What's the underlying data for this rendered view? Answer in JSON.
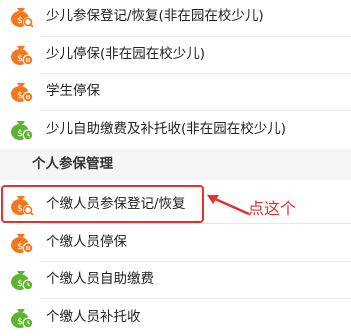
{
  "colors": {
    "accent": "#e5322d",
    "orange_icon": "#f4771c",
    "green_icon": "#5cb531"
  },
  "menu_top": [
    {
      "label": "少儿参保登记/恢复(非在园在校少儿)",
      "icon": "orange-moneybag-search-icon"
    },
    {
      "label": "少儿停保(非在园在校少儿)",
      "icon": "orange-moneybag-pause-icon"
    },
    {
      "label": "学生停保",
      "icon": "orange-moneybag-pause-icon"
    },
    {
      "label": "少儿自助缴费及补托收(非在园在校少儿)",
      "icon": "green-moneybag-clock-icon"
    }
  ],
  "section": {
    "title": "个人参保管理"
  },
  "menu_bottom": [
    {
      "label": "个缴人员参保登记/恢复",
      "icon": "orange-moneybag-search-icon"
    },
    {
      "label": "个缴人员停保",
      "icon": "orange-moneybag-pause-icon"
    },
    {
      "label": "个缴人员自助缴费",
      "icon": "green-moneybag-clock-icon"
    },
    {
      "label": "个缴人员补托收",
      "icon": "green-moneybag-clock-icon"
    }
  ],
  "annotation": {
    "callout_text": "点这个"
  }
}
